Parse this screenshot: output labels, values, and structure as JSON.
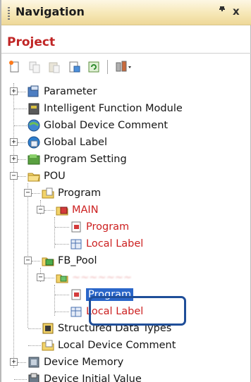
{
  "window": {
    "title": "Navigation",
    "pin_glyph": "Ɑ",
    "close_glyph": "x"
  },
  "project": {
    "title": "Project"
  },
  "toolbar": {
    "icons": [
      "new-item-icon",
      "copy-icon",
      "paste-icon",
      "properties-icon",
      "refresh-icon",
      "tools-dropdown-icon"
    ]
  },
  "tree": {
    "parameter": "Parameter",
    "intelligent_function_module": "Intelligent Function Module",
    "global_device_comment": "Global Device Comment",
    "global_label": "Global Label",
    "program_setting": "Program Setting",
    "pou": "POU",
    "program_folder": "Program",
    "main": "MAIN",
    "main_program": "Program",
    "main_local_label": "Local Label",
    "fb_pool": "FB_Pool",
    "fb_program": "Program",
    "fb_local_label": "Local Label",
    "structured_data_types": "Structured Data Types",
    "local_device_comment": "Local Device Comment",
    "device_memory": "Device Memory",
    "device_initial_value": "Device Initial Value"
  },
  "colors": {
    "title_bar": "#f6e7b6",
    "project_text": "#c02525",
    "red_item": "#cc1f1f",
    "selection": "#2a66c9",
    "highlight_border": "#1f4e99"
  }
}
